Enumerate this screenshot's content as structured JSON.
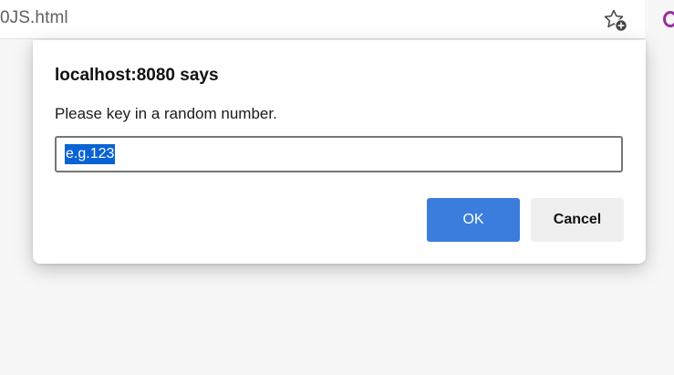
{
  "browser": {
    "address_text": "0JS.html",
    "favorite_icon": "star-add-icon",
    "profile_icon": "profile-ring-icon",
    "profile_color": "#9a2fa3"
  },
  "dialog": {
    "title": "localhost:8080 says",
    "message": "Please key in a random number.",
    "input": {
      "value": "e.g.123",
      "selected": true
    },
    "ok_label": "OK",
    "cancel_label": "Cancel",
    "ok_color": "#3b7ddc",
    "selection_color": "#0a63d4"
  }
}
